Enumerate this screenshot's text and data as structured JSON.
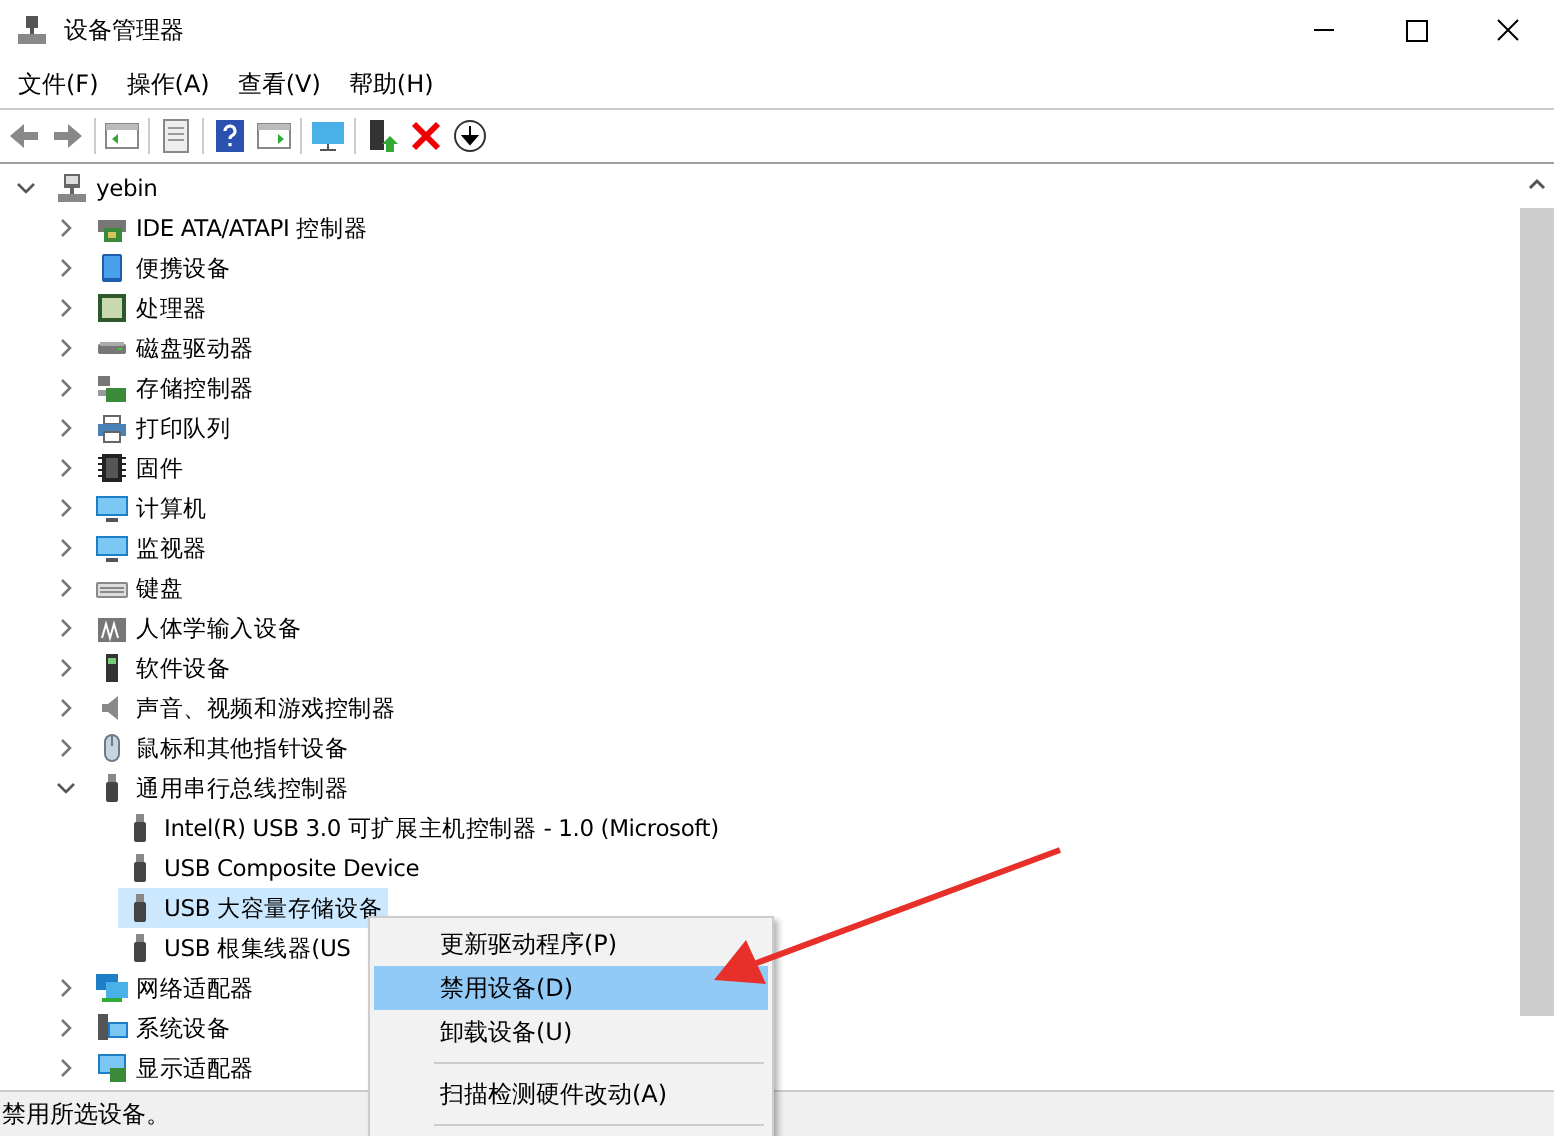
{
  "window": {
    "title": "设备管理器"
  },
  "menu_bar": [
    "文件(F)",
    "操作(A)",
    "查看(V)",
    "帮助(H)"
  ],
  "tree": {
    "label": "yebin",
    "kind": "computer",
    "expanded": true,
    "selected": false,
    "children": [
      {
        "label": "IDE ATA/ATAPI 控制器",
        "kind": "ide",
        "expanded": false,
        "selected": false
      },
      {
        "label": "便携设备",
        "kind": "portable",
        "expanded": false,
        "selected": false
      },
      {
        "label": "处理器",
        "kind": "cpu",
        "expanded": false,
        "selected": false
      },
      {
        "label": "磁盘驱动器",
        "kind": "disk",
        "expanded": false,
        "selected": false
      },
      {
        "label": "存储控制器",
        "kind": "storage",
        "expanded": false,
        "selected": false
      },
      {
        "label": "打印队列",
        "kind": "printer",
        "expanded": false,
        "selected": false
      },
      {
        "label": "固件",
        "kind": "firmware",
        "expanded": false,
        "selected": false
      },
      {
        "label": "计算机",
        "kind": "monitor",
        "expanded": false,
        "selected": false
      },
      {
        "label": "监视器",
        "kind": "monitor",
        "expanded": false,
        "selected": false
      },
      {
        "label": "键盘",
        "kind": "keyboard",
        "expanded": false,
        "selected": false
      },
      {
        "label": "人体学输入设备",
        "kind": "hid",
        "expanded": false,
        "selected": false
      },
      {
        "label": "软件设备",
        "kind": "software",
        "expanded": false,
        "selected": false
      },
      {
        "label": "声音、视频和游戏控制器",
        "kind": "audio",
        "expanded": false,
        "selected": false
      },
      {
        "label": "鼠标和其他指针设备",
        "kind": "mouse",
        "expanded": false,
        "selected": false
      },
      {
        "label": "通用串行总线控制器",
        "kind": "usb",
        "expanded": true,
        "selected": false,
        "children": [
          {
            "label": "Intel(R) USB 3.0 可扩展主机控制器 - 1.0 (Microsoft)",
            "kind": "usb",
            "selected": false
          },
          {
            "label": "USB Composite Device",
            "kind": "usb",
            "selected": false
          },
          {
            "label": "USB 大容量存储设备",
            "kind": "usb",
            "selected": true
          },
          {
            "label": "USB 根集线器(US",
            "kind": "usb",
            "selected": false
          }
        ]
      },
      {
        "label": "网络适配器",
        "kind": "network",
        "expanded": false,
        "selected": false
      },
      {
        "label": "系统设备",
        "kind": "system",
        "expanded": false,
        "selected": false
      },
      {
        "label": "显示适配器",
        "kind": "display",
        "expanded": false,
        "selected": false
      }
    ]
  },
  "context_menu": {
    "items": [
      {
        "kind": "item",
        "label": "更新驱动程序(P)",
        "selected": false
      },
      {
        "kind": "item",
        "label": "禁用设备(D)",
        "selected": true
      },
      {
        "kind": "item",
        "label": "卸载设备(U)",
        "selected": false
      },
      {
        "kind": "separator"
      },
      {
        "kind": "item",
        "label": "扫描检测硬件改动(A)",
        "selected": false
      },
      {
        "kind": "separator"
      }
    ]
  },
  "status_bar": "禁用所选设备。"
}
